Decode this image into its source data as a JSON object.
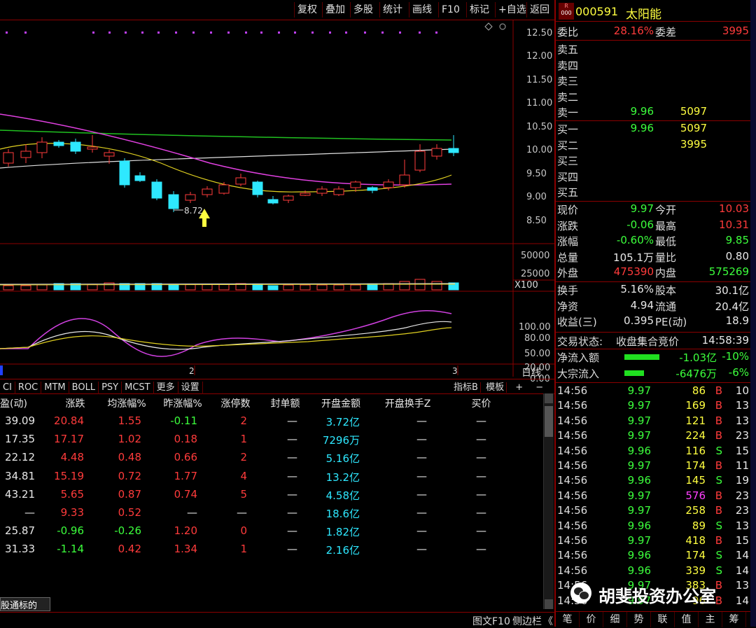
{
  "toolbar": {
    "items": [
      "复权",
      "叠加",
      "多股",
      "统计",
      "画线",
      "F10",
      "标记",
      "+自选",
      "返回"
    ]
  },
  "price_axis": [
    "12.50",
    "12.00",
    "11.50",
    "11.00",
    "10.50",
    "10.00",
    "9.50",
    "9.00",
    "8.50"
  ],
  "low_marker": "8.72",
  "volume_axis": [
    "50000",
    "25000"
  ],
  "volume_unit": "X100",
  "kdj_axis": [
    "100.00",
    "80.00",
    "50.00",
    "20.00",
    "0.00"
  ],
  "period_marks": [
    "2",
    "3"
  ],
  "period_label": "日线",
  "indicator_tabs": [
    "CI",
    "ROC",
    "MTM",
    "BOLL",
    "PSY",
    "MCST",
    "更多",
    "设置"
  ],
  "indicator_right": {
    "btn1": "指标B",
    "btn2": "模板",
    "plus": "+",
    "minus": "−"
  },
  "table": {
    "headers": [
      "盈(动)",
      "涨跌",
      "均涨幅%",
      "昨涨幅%",
      "涨停数",
      "封单额",
      "开盘金额",
      "开盘换手Z",
      "买价"
    ],
    "rows": [
      [
        "39.09",
        "20.84",
        "1.55",
        "-0.11",
        "2",
        "—",
        "3.72亿",
        "—",
        "—"
      ],
      [
        "17.35",
        "17.17",
        "1.02",
        "0.18",
        "1",
        "—",
        "7296万",
        "—",
        "—"
      ],
      [
        "22.12",
        "4.48",
        "0.48",
        "0.66",
        "2",
        "—",
        "5.16亿",
        "—",
        "—"
      ],
      [
        "34.81",
        "15.19",
        "0.72",
        "1.77",
        "4",
        "—",
        "13.2亿",
        "—",
        "—"
      ],
      [
        "43.21",
        "5.65",
        "0.87",
        "0.74",
        "5",
        "—",
        "4.58亿",
        "—",
        "—"
      ],
      [
        "—",
        "9.33",
        "0.52",
        "—",
        "—",
        "—",
        "18.6亿",
        "—",
        "—"
      ],
      [
        "25.87",
        "-0.96",
        "-0.26",
        "1.20",
        "0",
        "—",
        "1.82亿",
        "—",
        "—"
      ],
      [
        "31.33",
        "-1.14",
        "0.42",
        "1.34",
        "1",
        "—",
        "2.16亿",
        "—",
        "—"
      ]
    ],
    "footer_tab": "股通标的"
  },
  "status_bar": {
    "f10": "图文F10",
    "side": "侧边栏",
    "arrow": "《"
  },
  "stock": {
    "badge_top": "R",
    "badge_bottom": "000",
    "code": "000591",
    "name": "太阳能"
  },
  "weibi": {
    "label1": "委比",
    "value1": "28.16%",
    "label2": "委差",
    "value2": "3995"
  },
  "sell": [
    {
      "label": "卖五",
      "price": "",
      "vol": ""
    },
    {
      "label": "卖四",
      "price": "",
      "vol": ""
    },
    {
      "label": "卖三",
      "price": "",
      "vol": ""
    },
    {
      "label": "卖二",
      "price": "",
      "vol": ""
    },
    {
      "label": "卖一",
      "price": "9.96",
      "vol": "5097"
    }
  ],
  "buy": [
    {
      "label": "买一",
      "price": "9.96",
      "vol": "5097"
    },
    {
      "label": "买二",
      "price": "",
      "vol": "3995"
    },
    {
      "label": "买三",
      "price": "",
      "vol": ""
    },
    {
      "label": "买四",
      "price": "",
      "vol": ""
    },
    {
      "label": "买五",
      "price": "",
      "vol": ""
    }
  ],
  "quote": [
    {
      "l1": "现价",
      "v1": "9.97",
      "l2": "今开",
      "v2": "10.03"
    },
    {
      "l1": "涨跌",
      "v1": "-0.06",
      "l2": "最高",
      "v2": "10.31"
    },
    {
      "l1": "涨幅",
      "v1": "-0.60%",
      "l2": "最低",
      "v2": "9.85"
    },
    {
      "l1": "总量",
      "v1": "105.1万",
      "l2": "量比",
      "v2": "0.80"
    },
    {
      "l1": "外盘",
      "v1": "475390",
      "l2": "内盘",
      "v2": "575269"
    }
  ],
  "quote2": [
    {
      "l1": "换手",
      "v1": "5.16%",
      "l2": "股本",
      "v2": "30.1亿"
    },
    {
      "l1": "净资",
      "v1": "4.94",
      "l2": "流通",
      "v2": "20.4亿"
    },
    {
      "l1": "收益(三)",
      "v1": "0.395",
      "l2": "PE(动)",
      "v2": "18.9"
    }
  ],
  "trade_status": {
    "label": "交易状态:",
    "value": "收盘集合竞价",
    "time": "14:58:39"
  },
  "flows": [
    {
      "label": "净流入额",
      "value": "-1.03亿",
      "pct": "-10%"
    },
    {
      "label": "大宗流入",
      "value": "-6476万",
      "pct": "-6%"
    }
  ],
  "ticks": [
    {
      "time": "14:56",
      "price": "9.97",
      "vol": "86",
      "bs": "B",
      "n": "10"
    },
    {
      "time": "14:56",
      "price": "9.97",
      "vol": "169",
      "bs": "B",
      "n": "13"
    },
    {
      "time": "14:56",
      "price": "9.97",
      "vol": "121",
      "bs": "B",
      "n": "13"
    },
    {
      "time": "14:56",
      "price": "9.97",
      "vol": "224",
      "bs": "B",
      "n": "23"
    },
    {
      "time": "14:56",
      "price": "9.96",
      "vol": "116",
      "bs": "S",
      "n": "15"
    },
    {
      "time": "14:56",
      "price": "9.97",
      "vol": "174",
      "bs": "B",
      "n": "11"
    },
    {
      "time": "14:56",
      "price": "9.96",
      "vol": "145",
      "bs": "S",
      "n": "19"
    },
    {
      "time": "14:56",
      "price": "9.97",
      "vol": "576",
      "bs": "B",
      "n": "23"
    },
    {
      "time": "14:56",
      "price": "9.97",
      "vol": "258",
      "bs": "B",
      "n": "23"
    },
    {
      "time": "14:56",
      "price": "9.96",
      "vol": "89",
      "bs": "S",
      "n": "13"
    },
    {
      "time": "14:56",
      "price": "9.97",
      "vol": "418",
      "bs": "B",
      "n": "15"
    },
    {
      "time": "14:56",
      "price": "9.96",
      "vol": "174",
      "bs": "S",
      "n": "14"
    },
    {
      "time": "14:56",
      "price": "9.96",
      "vol": "339",
      "bs": "S",
      "n": "14"
    },
    {
      "time": "14:56",
      "price": "9.97",
      "vol": "383",
      "bs": "B",
      "n": "13"
    },
    {
      "time": "14:56",
      "price": "9.97",
      "vol": "96",
      "bs": "B",
      "n": "14"
    }
  ],
  "bottom_tabs": [
    "笔",
    "价",
    "细",
    "势",
    "联",
    "值",
    "主",
    "筹"
  ],
  "watermark": "胡斐投资办公室",
  "colors": {
    "up": "#ff3b3b",
    "down": "#3cff3c",
    "cyan": "#2ee8ff",
    "frame": "#8b0000",
    "yellow": "#ffff40",
    "magenta": "#ff40ff"
  }
}
